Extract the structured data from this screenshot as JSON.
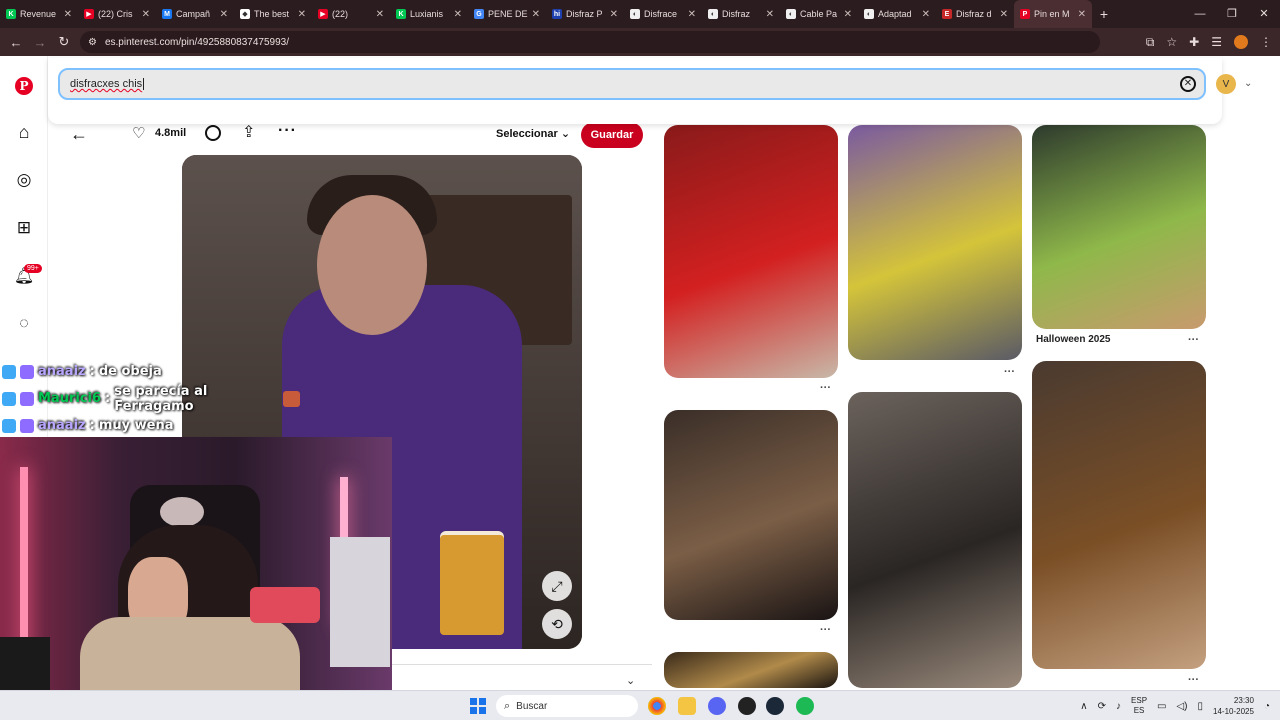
{
  "browser": {
    "tabs": [
      {
        "label": "Revenue",
        "color": "#00c853",
        "glyph": "K"
      },
      {
        "label": "(22) Cris",
        "color": "#e60023",
        "glyph": "▶"
      },
      {
        "label": "Campañ",
        "color": "#1877f2",
        "glyph": "M"
      },
      {
        "label": "The best",
        "color": "#ffffff",
        "glyph": "◆"
      },
      {
        "label": "(22)",
        "color": "#e60023",
        "glyph": "▶"
      },
      {
        "label": "Luxianis",
        "color": "#00c853",
        "glyph": "K"
      },
      {
        "label": "PENE DE",
        "color": "#4285f4",
        "glyph": "G"
      },
      {
        "label": "Disfraz P",
        "color": "#1e40af",
        "glyph": "hi"
      },
      {
        "label": "Disfrace",
        "color": "#f0f0f0",
        "glyph": "◐"
      },
      {
        "label": "Disfraz",
        "color": "#f0f0f0",
        "glyph": "◐"
      },
      {
        "label": "Cable Pa",
        "color": "#f0f0f0",
        "glyph": "◐"
      },
      {
        "label": "Adaptad",
        "color": "#f0f0f0",
        "glyph": "◐"
      },
      {
        "label": "Disfraz d",
        "color": "#c62828",
        "glyph": "E"
      },
      {
        "label": "Pin en M",
        "color": "#e60023",
        "glyph": "P",
        "active": true
      }
    ],
    "new_tab": "+",
    "url": "es.pinterest.com/pin/4925880837475993/"
  },
  "search": {
    "query": "disfracxes chis",
    "avatar_letter": "V"
  },
  "rail": {
    "notifications_badge": "99+"
  },
  "pin": {
    "like_count": "4.8mil",
    "select_label": "Seleccionar",
    "save_label": "Guardar"
  },
  "grid": [
    {
      "caption": "",
      "colors": [
        "#8a1a1a",
        "#d32020",
        "#c8b8a8"
      ]
    },
    {
      "caption": "",
      "colors": [
        "#7a5aa0",
        "#d4c43a",
        "#5a5a66"
      ]
    },
    {
      "caption": "Halloween 2025",
      "colors": [
        "#2d3a2d",
        "#8fb84a",
        "#c89a6e"
      ]
    },
    {
      "caption": "",
      "colors": [
        "#3a2e28",
        "#7b5e46",
        "#1a1414"
      ]
    },
    {
      "caption": "",
      "colors": [
        "#6b625c",
        "#2a2624",
        "#9a8a7c"
      ]
    },
    {
      "caption": "",
      "colors": [
        "#4a3a30",
        "#7a4f26",
        "#c4a080"
      ]
    },
    {
      "caption": "",
      "colors": [
        "#3a2a1a",
        "#b08a4a",
        "#1a1410"
      ]
    }
  ],
  "chat": [
    {
      "user": "anaaiz",
      "message": "de obeja",
      "user_color": "#b8a6ff"
    },
    {
      "user": "Maurici6",
      "message": "se parecía al Ferragamo",
      "user_color": "#00c853"
    },
    {
      "user": "anaaiz",
      "message": "muy wena",
      "user_color": "#b8a6ff"
    }
  ],
  "taskbar": {
    "search_placeholder": "Buscar",
    "lang_top": "ESP",
    "lang_bottom": "ES",
    "time": "23:30",
    "date": "14-10-2025"
  }
}
